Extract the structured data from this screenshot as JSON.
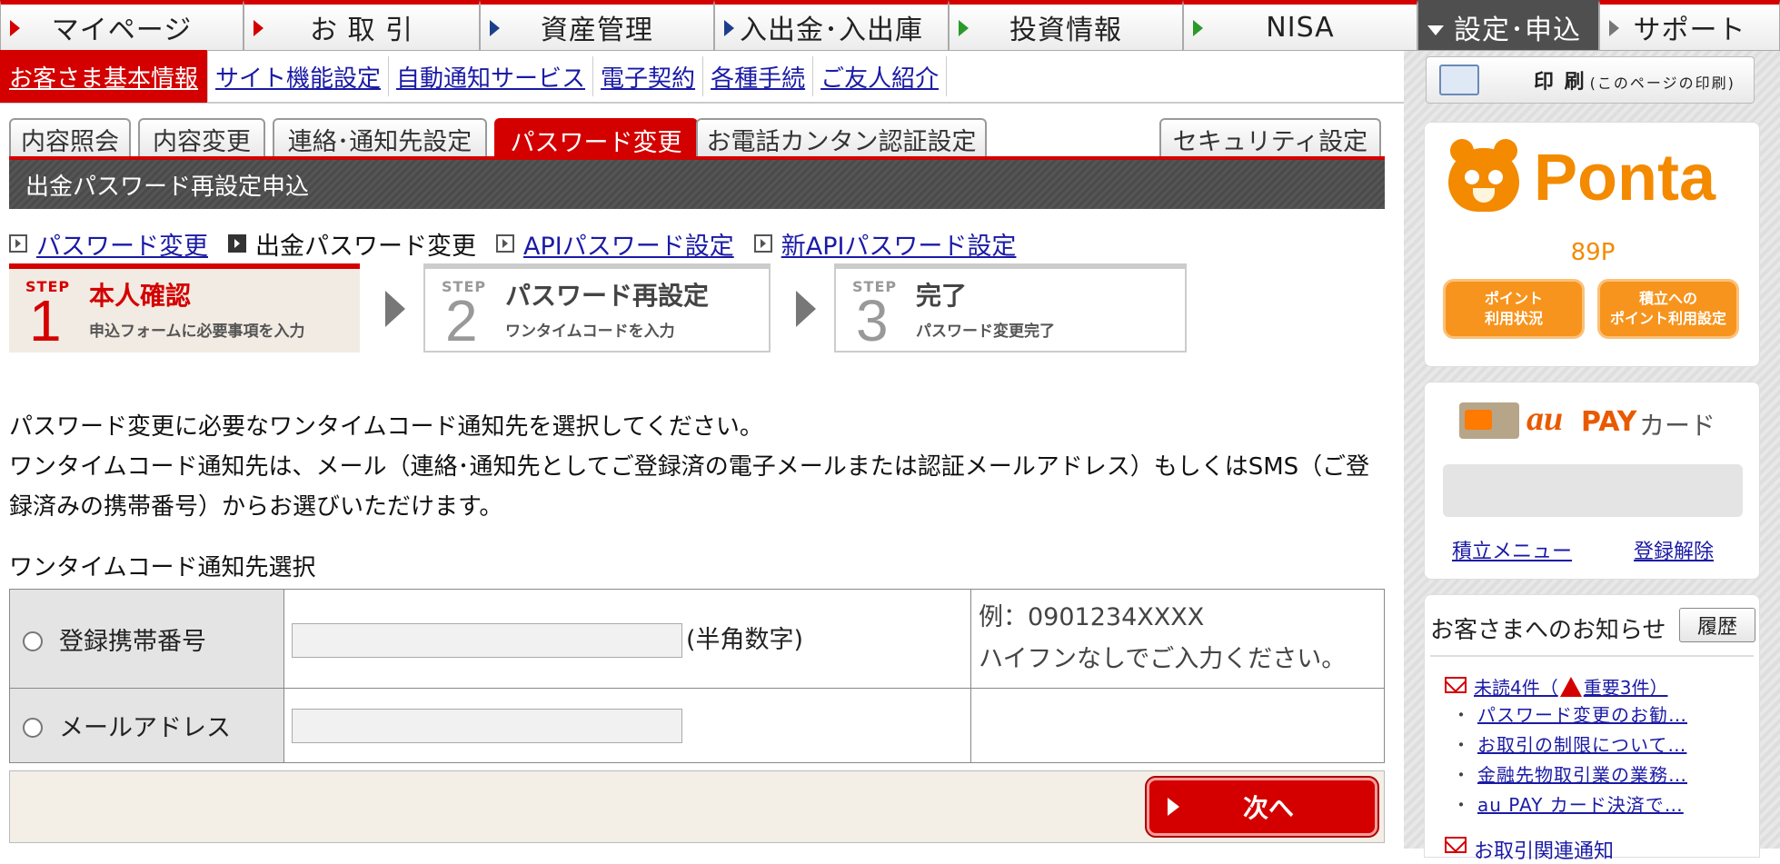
{
  "topnav": {
    "items": [
      {
        "label": "マイページ"
      },
      {
        "label": "お 取 引"
      },
      {
        "label": "資産管理"
      },
      {
        "label": "入出金･入出庫"
      },
      {
        "label": "投資情報"
      },
      {
        "label": "NISA"
      },
      {
        "label": "設定･申込"
      },
      {
        "label": "サポート"
      }
    ],
    "active_index": 6
  },
  "subnav": {
    "items": [
      {
        "label": "お客さま基本情報"
      },
      {
        "label": "サイト機能設定"
      },
      {
        "label": "自動通知サービス"
      },
      {
        "label": "電子契約"
      },
      {
        "label": "各種手続"
      },
      {
        "label": "ご友人紹介"
      }
    ]
  },
  "print": {
    "label": "印 刷",
    "sub": "(このページの印刷)"
  },
  "tabs": {
    "items": [
      {
        "label": "内容照会"
      },
      {
        "label": "内容変更"
      },
      {
        "label": "連絡･通知先設定"
      },
      {
        "label": "パスワード変更"
      },
      {
        "label": "お電話カンタン認証設定"
      },
      {
        "label": "セキュリティ設定"
      }
    ]
  },
  "section_title": "出金パスワード再設定申込",
  "sublinks": [
    {
      "label": "パスワード変更"
    },
    {
      "label": "出金パスワード変更"
    },
    {
      "label": "APIパスワード設定"
    },
    {
      "label": "新APIパスワード設定"
    }
  ],
  "steps": [
    {
      "step": "STEP",
      "num": "1",
      "title": "本人確認",
      "sub": "申込フォームに必要事項を入力"
    },
    {
      "step": "STEP",
      "num": "2",
      "title": "パスワード再設定",
      "sub": "ワンタイムコードを入力"
    },
    {
      "step": "STEP",
      "num": "3",
      "title": "完了",
      "sub": "パスワード変更完了"
    }
  ],
  "instructions": [
    "パスワード変更に必要なワンタイムコード通知先を選択してください。",
    "ワンタイムコード通知先は、メール（連絡･通知先としてご登録済の電子メールまたは認証メールアドレス）もしくはSMS（ご登録済みの携帯番号）からお選びいただけます。"
  ],
  "onetime": {
    "label": "ワンタイムコード通知先選択",
    "rows": [
      {
        "label": "登録携帯番号",
        "value": "",
        "hint": "(半角数字)",
        "note1": "例：0901234XXXX",
        "note2": "ハイフンなしでご入力ください。"
      },
      {
        "label": "メールアドレス",
        "value": ""
      }
    ]
  },
  "next_label": "次へ",
  "ponta": {
    "name": "Ponta",
    "points": "89P",
    "btn1": "ポイント\n利用状況",
    "btn2": "積立への\nポイント利用設定"
  },
  "aupay": {
    "brand": "au",
    "pay": "PAY",
    "card": "カード",
    "link1": "積立メニュー",
    "link2": "登録解除"
  },
  "notice": {
    "title": "お客さまへのお知らせ",
    "history": "履歴",
    "unread_pre": "未読4件（",
    "unread_imp": "重要3件",
    "unread_post": "）",
    "items": [
      {
        "text": "パスワード変更のお勧…"
      },
      {
        "text": "お取引の制限について…"
      },
      {
        "text": "金融先物取引業の業務…"
      },
      {
        "text": "au PAY カード決済で…"
      }
    ],
    "trade": "お取引関連通知"
  },
  "colors": {
    "brand_red": "#d40000",
    "ponta_orange": "#f38a00",
    "link": "#1a1aa6"
  }
}
